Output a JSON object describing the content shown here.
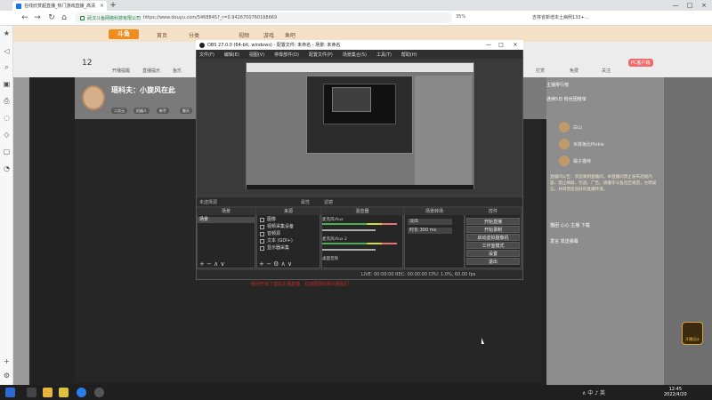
{
  "browser": {
    "tab_title": "在线欣赏超直播_热门游戏直播_高清",
    "close": "×",
    "new_tab": "+",
    "window_buttons": [
      "—",
      "□",
      "×"
    ],
    "nav": [
      "←",
      "→",
      "↻",
      "⌂"
    ],
    "url_org": "武汉斗鱼网络科技有限公司",
    "url": "https://www.douyu.com/5468845?_r=0.9426700760168669",
    "zoom": "35%",
    "news": "吉林省新增本土病例133+..."
  },
  "sidebar": {
    "icons": [
      "★",
      "◁",
      "⌕",
      "▣",
      "⎙",
      "◌",
      "◇",
      "▢",
      "◔",
      "▤",
      "+",
      "⚙"
    ]
  },
  "douyu": {
    "logo": "斗鱼",
    "nav": [
      "首页",
      "分类",
      "视频",
      "游戏",
      "鱼吧"
    ],
    "sub": [
      "12",
      "开播提醒",
      "直播提示",
      "鱼乐",
      "打赏",
      "免费",
      "关注",
      "PC客户端"
    ],
    "streamer": "瑶科夫：小旋风在此",
    "room_title": "",
    "tags": [
      "二次元",
      "机器人",
      "新手",
      "聊天",
      "全屏"
    ],
    "player_msg_prefix": "房间开启了",
    "player_msg_highlight": "虚拟主播",
    "player_msg_suffix": "直播，欢迎围观的观众朋友们"
  },
  "right_panel": {
    "head": "主播排行榜",
    "row2": "连续5日 粉丝团榜单",
    "users": [
      "白山",
      "米菲兔比Pinkie",
      "橘子猫咪"
    ],
    "notice": "直播间公告：欢迎来到直播间，本直播间禁止发布违规内容，禁止刷屏、引战、广告。请遵守斗鱼社区规范，文明发言，共同营造良好的直播环境。",
    "tags": "猫团 心心 主播 下载",
    "tags2": "发言 发送弹幕"
  },
  "game_corner": "开播设计",
  "obs": {
    "title": "OBS 27.0.0 (64-bit, windows) - 配置文件: 未命名 - 场景: 未命名",
    "window_buttons": [
      "—",
      "□",
      "×"
    ],
    "menu": [
      "文件(F)",
      "编辑(E)",
      "视图(V)",
      "停靠部件(D)",
      "配置文件(P)",
      "场景集合(S)",
      "工具(T)",
      "帮助(H)"
    ],
    "status1": "未选择源",
    "props": "属性",
    "filters": "滤镜",
    "docks": {
      "scenes": {
        "title": "场景",
        "item": "场景",
        "footer": "+ − ∧ ∨"
      },
      "sources": {
        "title": "来源",
        "items": [
          "图像",
          "视频采集设备",
          "音频源",
          "文本 (GDI+)",
          "显示器采集"
        ],
        "footer": "+ − ⚙ ∧ ∨"
      },
      "mixer": {
        "title": "混音器",
        "channels": [
          "麦克风/Aux",
          "麦克风/Aux 2",
          "桌面音频"
        ]
      },
      "transitions": {
        "title": "场景转场",
        "mode": "淡出",
        "duration": "时长  300 ms"
      },
      "controls": {
        "title": "控件",
        "buttons": [
          "开始直播",
          "开始录制",
          "启动虚拟摄像机",
          "工作室模式",
          "设置",
          "退出"
        ]
      }
    },
    "status2": "LIVE: 00:00:00   REC: 00:00:00   CPU: 1.0%, 60.00 fps"
  },
  "taskbar": {
    "tray": "∧ 中 ♪ 英",
    "time": "12:45",
    "date": "2022/4/20"
  }
}
